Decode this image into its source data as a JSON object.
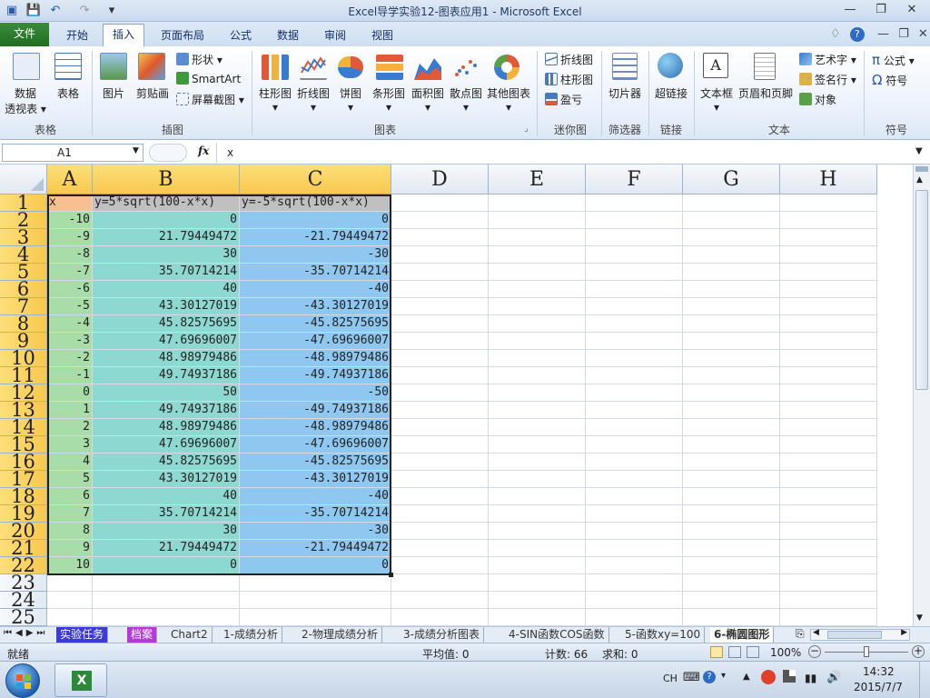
{
  "window": {
    "title": "Excel导学实验12-图表应用1 - Microsoft Excel"
  },
  "tabs": [
    "文件",
    "开始",
    "插入",
    "页面布局",
    "公式",
    "数据",
    "审阅",
    "视图"
  ],
  "ribbon": {
    "groups": [
      "表格",
      "插图",
      "图表",
      "迷你图",
      "筛选器",
      "链接",
      "文本",
      "符号"
    ],
    "table_buttons": {
      "pivot_line1": "数据",
      "pivot_line2": "透视表",
      "table": "表格"
    },
    "illustration_buttons": {
      "picture": "图片",
      "clipart": "剪贴画",
      "shapes": "形状",
      "smartart": "SmartArt",
      "screenshot": "屏幕截图"
    },
    "chart_buttons": [
      "柱形图",
      "折线图",
      "饼图",
      "条形图",
      "面积图",
      "散点图",
      "其他图表"
    ],
    "sparkline_buttons": [
      "折线图",
      "柱形图",
      "盈亏"
    ],
    "slicer": "切片器",
    "hyperlink": "超链接",
    "text_buttons": {
      "textbox": "文本框",
      "header_footer": "页眉和页脚",
      "wordart": "艺术字",
      "signature": "签名行",
      "object": "对象"
    },
    "symbol_buttons": {
      "equation": "公式",
      "symbol": "符号"
    }
  },
  "formula_bar": {
    "name_box": "A1",
    "fx": "fx",
    "formula": "x"
  },
  "columns": [
    "A",
    "B",
    "C",
    "D",
    "E",
    "F",
    "G",
    "H"
  ],
  "rows": [
    "1",
    "2",
    "3",
    "4",
    "5",
    "6",
    "7",
    "8",
    "9",
    "10",
    "11",
    "12",
    "13",
    "14",
    "15",
    "16",
    "17",
    "18",
    "19",
    "20",
    "21",
    "22",
    "23",
    "24",
    "25"
  ],
  "headers": {
    "a": "x",
    "b": "y=5*sqrt(100-x*x)",
    "c": "y=-5*sqrt(100-x*x)"
  },
  "table": [
    [
      "-10",
      "0",
      "0"
    ],
    [
      "-9",
      "21.79449472",
      "-21.79449472"
    ],
    [
      "-8",
      "30",
      "-30"
    ],
    [
      "-7",
      "35.70714214",
      "-35.70714214"
    ],
    [
      "-6",
      "40",
      "-40"
    ],
    [
      "-5",
      "43.30127019",
      "-43.30127019"
    ],
    [
      "-4",
      "45.82575695",
      "-45.82575695"
    ],
    [
      "-3",
      "47.69696007",
      "-47.69696007"
    ],
    [
      "-2",
      "48.98979486",
      "-48.98979486"
    ],
    [
      "-1",
      "49.74937186",
      "-49.74937186"
    ],
    [
      "0",
      "50",
      "-50"
    ],
    [
      "1",
      "49.74937186",
      "-49.74937186"
    ],
    [
      "2",
      "48.98979486",
      "-48.98979486"
    ],
    [
      "3",
      "47.69696007",
      "-47.69696007"
    ],
    [
      "4",
      "45.82575695",
      "-45.82575695"
    ],
    [
      "5",
      "43.30127019",
      "-43.30127019"
    ],
    [
      "6",
      "40",
      "-40"
    ],
    [
      "7",
      "35.70714214",
      "-35.70714214"
    ],
    [
      "8",
      "30",
      "-30"
    ],
    [
      "9",
      "21.79449472",
      "-21.79449472"
    ],
    [
      "10",
      "0",
      "0"
    ]
  ],
  "sheets": [
    "实验任务",
    "档案",
    "Chart2",
    "1-成绩分析",
    "2-物理成绩分析",
    "3-成绩分析图表",
    "4-SIN函数COS函数",
    "5-函数xy=100",
    "6-椭圆图形"
  ],
  "status": {
    "ready": "就绪",
    "average": "平均值: 0",
    "count": "计数: 66",
    "sum": "求和: 0",
    "zoom": "100%"
  },
  "taskbar": {
    "lang": "CH",
    "time": "14:32",
    "date": "2015/7/7"
  },
  "colors": {
    "col_a": "#a8dca8",
    "col_b": "#8dd8d0",
    "col_c": "#8ec8f0",
    "header_a": "#f8c090",
    "header_bc": "#c0c0c0",
    "file_tab": "#2a7a2a"
  }
}
